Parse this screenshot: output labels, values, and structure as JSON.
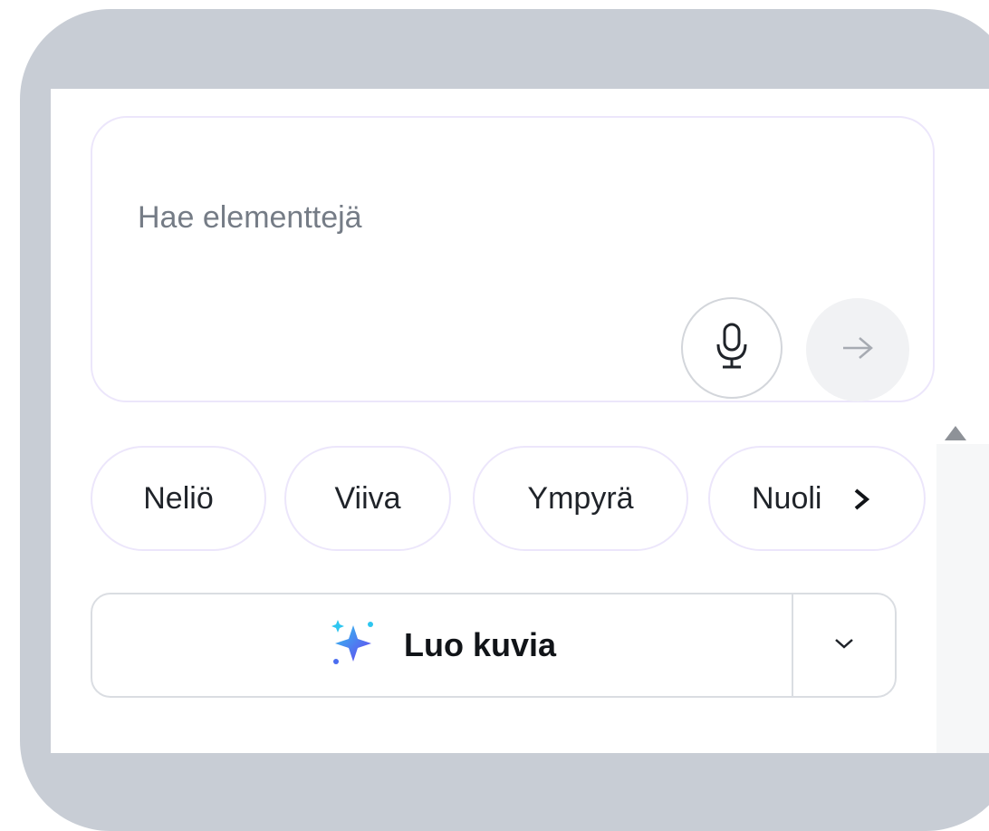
{
  "search": {
    "placeholder": "Hae elementtejä",
    "mic_icon": "microphone-icon",
    "send_icon": "arrow-right-icon"
  },
  "chips": [
    {
      "label": "Neliö"
    },
    {
      "label": "Viiva"
    },
    {
      "label": "Ympyrä"
    },
    {
      "label": "Nuoli"
    }
  ],
  "chip_scroll_icon": "chevron-right-icon",
  "create": {
    "label": "Luo kuvia",
    "icon": "sparkle-icon",
    "dropdown_icon": "chevron-down-icon"
  },
  "colors": {
    "frame": "#c8cdd5",
    "border": "#ece6fb",
    "sparkle_start": "#2ec6f0",
    "sparkle_end": "#6a3df0"
  }
}
